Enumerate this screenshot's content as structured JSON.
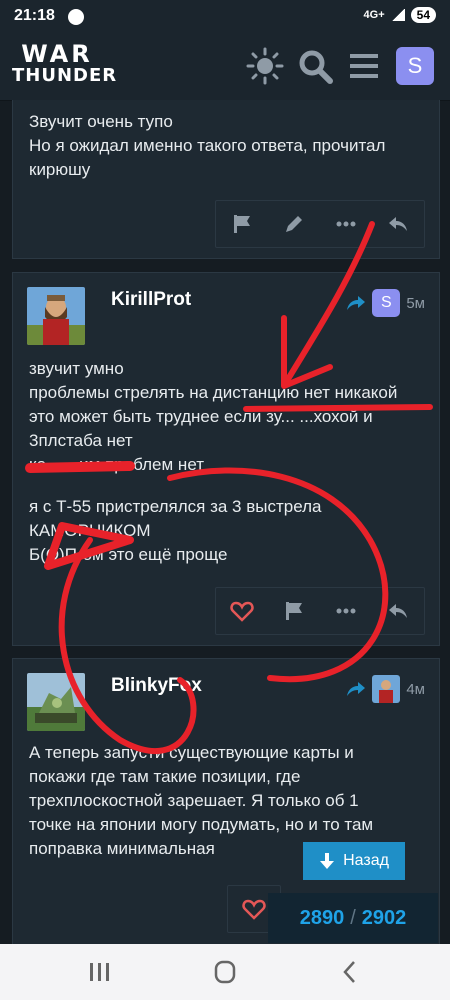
{
  "status": {
    "time": "21:18",
    "network": "4G+",
    "battery": "54"
  },
  "header": {
    "logo_line1": "WAR",
    "logo_line2": "THUNDER",
    "user_initial": "S"
  },
  "post_prev": {
    "lines": [
      "Звучит очень тупо",
      "Но я ожидал именно такого ответа, прочитал",
      "кирюшу"
    ]
  },
  "post_kirill": {
    "username": "KirillProt",
    "reply_avatar_initial": "S",
    "time": "5м",
    "lines": [
      "звучит умно",
      "проблемы стрелять на дистанцию нет никакой",
      "это может быть труднее если зу... ...хохой и",
      "3плстаба нет",
      "ко... ...им проблем нет"
    ],
    "lines2": [
      "я с Т-55 пристрелялся за 3 выстрела",
      "КАМОРНИКОМ",
      "Б(О)П-ом это ещё проще"
    ]
  },
  "post_blinky": {
    "username": "BlinkyFox",
    "time": "4м",
    "text": "А теперь запусти существующие карты и покажи где там такие позиции, где трехплоскостной зарешает. Я только об 1 точке на японии могу подумать, но и то там поправка минимальная"
  },
  "nav": {
    "back_label": "Назад",
    "current": "2890",
    "separator": "/",
    "total": "2902"
  },
  "colors": {
    "accent": "#1f8fc7",
    "avatar": "#8b8ff0",
    "annotation": "#e8222a"
  }
}
